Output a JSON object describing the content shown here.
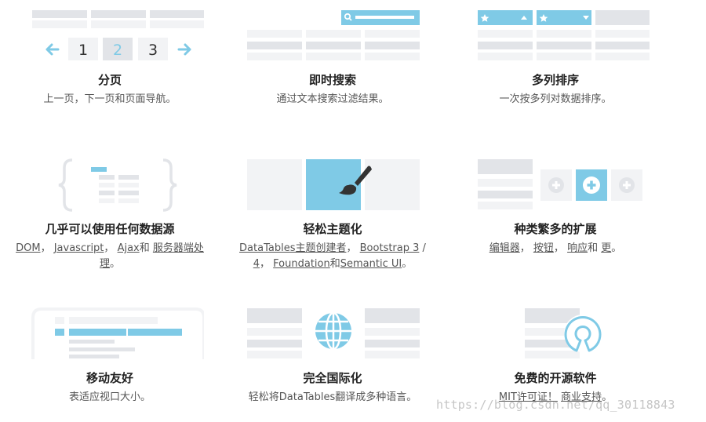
{
  "colors": {
    "accent": "#7fcae6",
    "block": "#e2e4e8",
    "light": "#f2f3f5",
    "text_dark": "#333333"
  },
  "features": [
    {
      "icon": "pagination-icon",
      "pages": [
        "1",
        "2",
        "3"
      ],
      "title": "分页",
      "desc": "上一页，下一页和页面导航。"
    },
    {
      "icon": "instant-search-icon",
      "title": "即时搜索",
      "desc": "通过文本搜索过滤结果。"
    },
    {
      "icon": "multi-column-sort-icon",
      "title": "多列排序",
      "desc": "一次按多列对数据排序。"
    },
    {
      "icon": "data-source-braces-icon",
      "title": "几乎可以使用任何数据源",
      "links": {
        "dom": "DOM",
        "js": "Javascript",
        "ajax": "Ajax",
        "server": "服务器端处理"
      },
      "text": {
        "sep1": "，",
        "sep2": "，",
        "and": "和",
        "end": "。"
      }
    },
    {
      "icon": "paint-brush-icon",
      "title": "轻松主题化",
      "links": {
        "creator": "DataTables主题创建者",
        "bs3": "Bootstrap 3",
        "bs4": "4",
        "foundation": "Foundation",
        "semantic": "Semantic UI"
      },
      "text": {
        "sep1": "，",
        "slash": "/",
        "sep2": "，",
        "and": "和",
        "end": "。"
      }
    },
    {
      "icon": "extensions-plus-icon",
      "title": "种类繁多的扩展",
      "links": {
        "editor": "编辑器",
        "buttons": "按钮",
        "responsive": "响应",
        "more": "更"
      },
      "text": {
        "sep1": "，",
        "sep2": "，",
        "and": "和",
        "end": "。"
      }
    },
    {
      "icon": "responsive-device-icon",
      "title": "移动友好",
      "desc": "表适应视口大小。"
    },
    {
      "icon": "globe-icon",
      "title": "完全国际化",
      "desc": "轻松将DataTables翻译成多种语言。"
    },
    {
      "icon": "open-source-icon",
      "title": "免费的开源软件",
      "links": {
        "mit": "MIT许可证！",
        "support": "商业支持"
      },
      "text": {
        "sep": "",
        "end": "。"
      }
    }
  ],
  "watermark": "https://blog.csdn.net/qq_30118843"
}
